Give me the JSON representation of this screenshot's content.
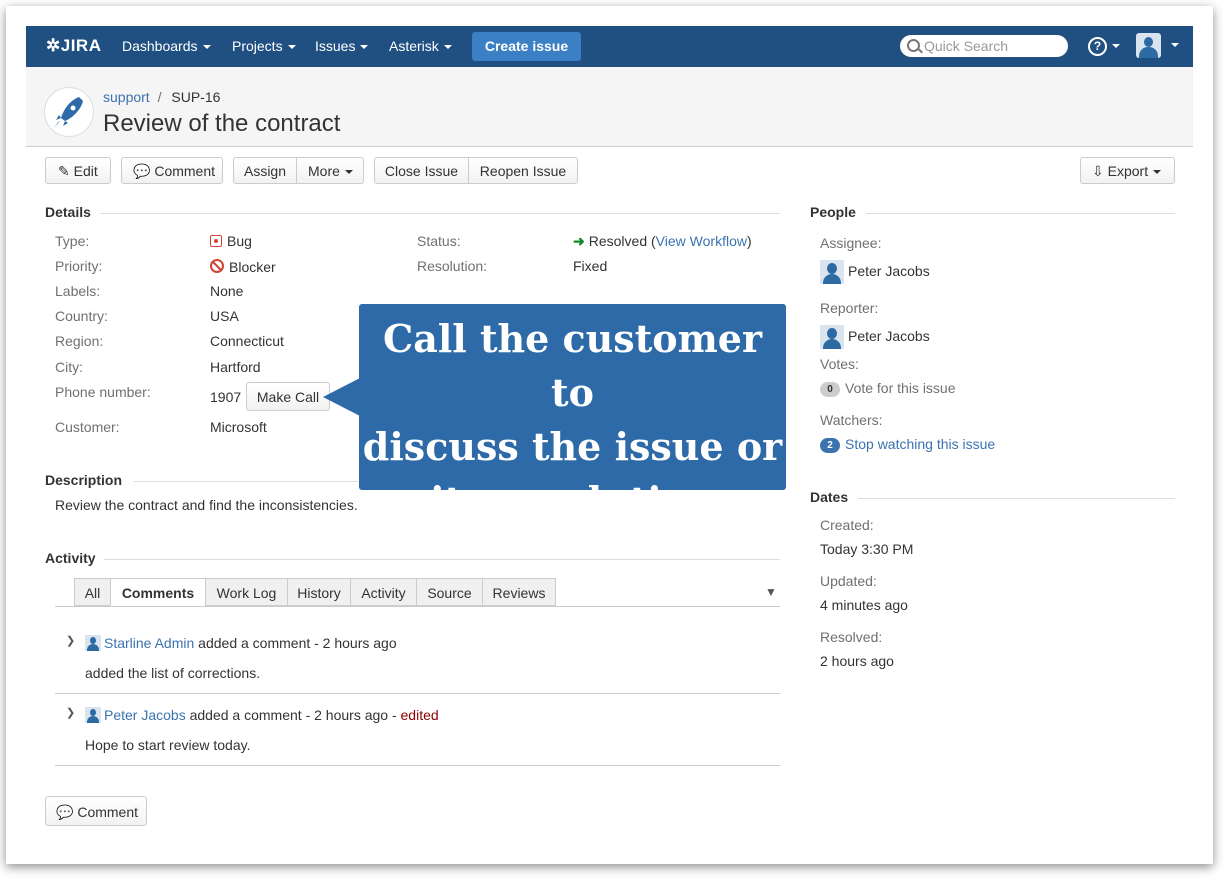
{
  "nav": {
    "logo": "JIRA",
    "menus": [
      "Dashboards",
      "Projects",
      "Issues",
      "Asterisk"
    ],
    "create": "Create issue",
    "search_placeholder": "Quick Search",
    "help": "?"
  },
  "issue": {
    "project": "support",
    "sep": "/",
    "key": "SUP-16",
    "summary": "Review of the contract"
  },
  "toolbar": {
    "edit": "Edit",
    "comment": "Comment",
    "assign": "Assign",
    "more": "More",
    "close": "Close Issue",
    "reopen": "Reopen Issue",
    "export": "Export"
  },
  "details": {
    "heading": "Details",
    "type_label": "Type:",
    "type": "Bug",
    "priority_label": "Priority:",
    "priority": "Blocker",
    "labels_label": "Labels:",
    "labels": "None",
    "country_label": "Country:",
    "country": "USA",
    "region_label": "Region:",
    "region": "Connecticut",
    "city_label": "City:",
    "city": "Hartford",
    "phone_label": "Phone number:",
    "phone": "1907",
    "make_call": "Make Call",
    "customer_label": "Customer:",
    "customer": "Microsoft",
    "status_label": "Status:",
    "status": "Resolved",
    "status_open": "(",
    "view_workflow": "View Workflow",
    "status_close": ")",
    "resolution_label": "Resolution:",
    "resolution": "Fixed"
  },
  "callout": {
    "line1": "Call the customer to",
    "line2": "discuss the issue or",
    "line3": "its resolution"
  },
  "description": {
    "heading": "Description",
    "text": "Review the contract and find the inconsistencies."
  },
  "activity": {
    "heading": "Activity",
    "tabs": [
      "All",
      "Comments",
      "Work Log",
      "History",
      "Activity",
      "Source",
      "Reviews"
    ],
    "comments": [
      {
        "author": "Starline Admin",
        "meta": "added a comment - 2 hours ago",
        "edited": "",
        "body": "added the list of corrections."
      },
      {
        "author": "Peter Jacobs",
        "meta": "added a comment - 2 hours ago -",
        "edited": "edited",
        "body": "Hope to start review today."
      }
    ],
    "comment_button": "Comment"
  },
  "people": {
    "heading": "People",
    "assignee_label": "Assignee:",
    "assignee": "Peter Jacobs",
    "reporter_label": "Reporter:",
    "reporter": "Peter Jacobs",
    "votes_label": "Votes:",
    "votes_count": "0",
    "votes_text": "Vote for this issue",
    "watchers_label": "Watchers:",
    "watchers_count": "2",
    "watchers_text": "Stop watching this issue"
  },
  "dates": {
    "heading": "Dates",
    "created_label": "Created:",
    "created": "Today 3:30 PM",
    "updated_label": "Updated:",
    "updated": "4 minutes ago",
    "resolved_label": "Resolved:",
    "resolved": "2 hours ago"
  },
  "colors": {
    "nav": "#205081",
    "link": "#3b73af",
    "callout": "#2d6aa7",
    "create": "#3b7fc4"
  }
}
